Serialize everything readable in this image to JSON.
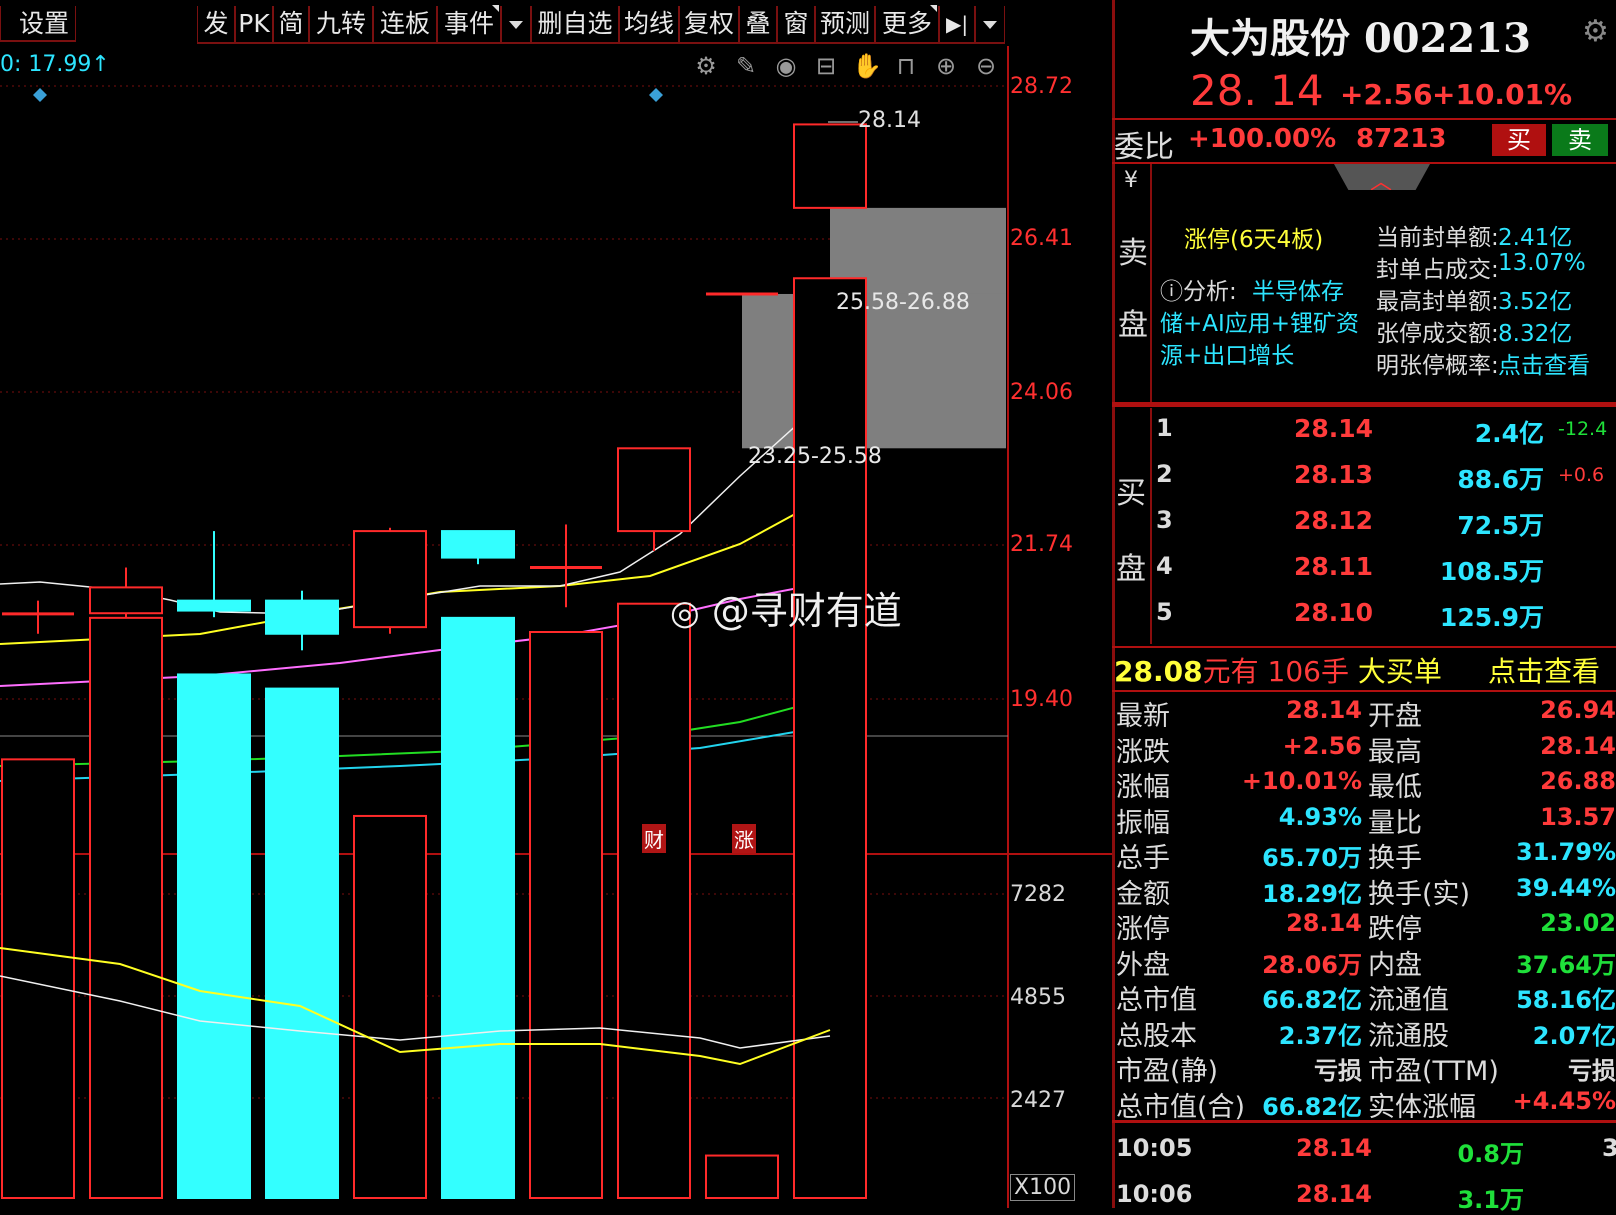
{
  "toolbar": {
    "items": [
      "设置",
      "发",
      "PK",
      "简",
      "九转",
      "连板",
      "事件",
      "",
      "删自选",
      "均线",
      "复权",
      "叠",
      "窗",
      "预测",
      "更多",
      "",
      ""
    ],
    "ma_readout": "0: 17.99↑"
  },
  "price_axis": [
    "28.72",
    "26.41",
    "24.06",
    "21.74",
    "19.40"
  ],
  "volume_axis": [
    "7282",
    "4855",
    "2427",
    "X100"
  ],
  "chart": {
    "high_label": "28.14",
    "zone_upper": "25.58-26.88",
    "zone_lower": "23.25-25.58",
    "markers": [
      "财",
      "涨"
    ],
    "watermark": "@寻财有道"
  },
  "chart_data": {
    "type": "candlestick",
    "candles": [
      {
        "o": 20.75,
        "c": 20.75,
        "h": 20.95,
        "l": 20.45
      },
      {
        "o": 20.76,
        "c": 21.15,
        "h": 21.45,
        "l": 20.65
      },
      {
        "o": 20.95,
        "c": 20.8,
        "h": 22.0,
        "l": 20.7
      },
      {
        "o": 20.95,
        "c": 20.45,
        "h": 21.1,
        "l": 20.2
      },
      {
        "o": 20.55,
        "c": 22.0,
        "h": 22.05,
        "l": 20.45
      },
      {
        "o": 22.0,
        "c": 21.6,
        "h": 22.0,
        "l": 21.5
      },
      {
        "o": 21.45,
        "c": 21.45,
        "h": 22.1,
        "l": 20.85
      },
      {
        "o": 22.0,
        "c": 23.25,
        "h": 23.25,
        "l": 21.7
      },
      {
        "o": 25.58,
        "c": 25.58,
        "h": 25.58,
        "l": 25.58
      },
      {
        "o": 26.88,
        "c": 28.14,
        "h": 28.14,
        "l": 26.88
      }
    ],
    "volume": [
      3100,
      4100,
      3700,
      3600,
      2700,
      4100,
      4000,
      4200,
      300,
      6500
    ],
    "volume_colors": [
      "red",
      "red",
      "cyan",
      "cyan",
      "red",
      "cyan",
      "red",
      "red",
      "red",
      "red"
    ]
  },
  "stock": {
    "name": "大为股份",
    "code": "002213",
    "price": "28. 14",
    "change": "+2.56",
    "pct": "+10.01%",
    "ratio_label": "委比",
    "ratio": "+100.00%",
    "ratio_vol": "87213",
    "buy": "买",
    "sell": "卖"
  },
  "limit": {
    "yen": "¥",
    "title": "涨停(6天4板)",
    "analysis_label": "ⓘ分析:",
    "analysis": [
      "半导体存",
      "储+AI应用+锂矿资",
      "源+出口增长"
    ],
    "stats": [
      {
        "k": "当前封单额:",
        "v": "2.41亿"
      },
      {
        "k": "封单占成交:",
        "v": "13.07%"
      },
      {
        "k": "最高封单额:",
        "v": "3.52亿"
      },
      {
        "k": "张停成交额:",
        "v": "8.32亿"
      },
      {
        "k": "明张停概率:",
        "v": "点击查看"
      }
    ],
    "sell_label": [
      "卖",
      "盘"
    ]
  },
  "bids": {
    "label": [
      "买",
      "盘"
    ],
    "rows": [
      {
        "n": "1",
        "p": "28.14",
        "v": "2.4亿",
        "d": "-12.4"
      },
      {
        "n": "2",
        "p": "28.13",
        "v": "88.6万",
        "d": "+0.6"
      },
      {
        "n": "3",
        "p": "28.12",
        "v": "72.5万",
        "d": ""
      },
      {
        "n": "4",
        "p": "28.11",
        "v": "108.5万",
        "d": ""
      },
      {
        "n": "5",
        "p": "28.10",
        "v": "125.9万",
        "d": ""
      }
    ]
  },
  "bigorder": {
    "price": "28.08",
    "t1": "元有",
    "count": "106手",
    "t2": "大买单",
    "link": "点击查看"
  },
  "quote": [
    {
      "k1": "最新",
      "v1": "28.14",
      "c1": "r",
      "k2": "开盘",
      "v2": "26.94",
      "c2": "r"
    },
    {
      "k1": "涨跌",
      "v1": "+2.56",
      "c1": "r",
      "k2": "最高",
      "v2": "28.14",
      "c2": "r"
    },
    {
      "k1": "涨幅",
      "v1": "+10.01%",
      "c1": "r",
      "k2": "最低",
      "v2": "26.88",
      "c2": "r"
    },
    {
      "k1": "振幅",
      "v1": "4.93%",
      "c1": "c",
      "k2": "量比",
      "v2": "13.57",
      "c2": "r"
    },
    {
      "k1": "总手",
      "v1": "65.70万",
      "c1": "c",
      "k2": "换手",
      "v2": "31.79%",
      "c2": "c"
    },
    {
      "k1": "金额",
      "v1": "18.29亿",
      "c1": "c",
      "k2": "换手(实)",
      "v2": "39.44%",
      "c2": "c"
    },
    {
      "k1": "涨停",
      "v1": "28.14",
      "c1": "r",
      "k2": "跌停",
      "v2": "23.02",
      "c2": "g"
    },
    {
      "k1": "外盘",
      "v1": "28.06万",
      "c1": "r",
      "k2": "内盘",
      "v2": "37.64万",
      "c2": "g"
    },
    {
      "k1": "总市值",
      "v1": "66.82亿",
      "c1": "c",
      "k2": "流通值",
      "v2": "58.16亿",
      "c2": "c"
    },
    {
      "k1": "总股本",
      "v1": "2.37亿",
      "c1": "c",
      "k2": "流通股",
      "v2": "2.07亿",
      "c2": "c"
    },
    {
      "k1": "市盈(静)",
      "v1": "亏损",
      "c1": "w",
      "k2": "市盈(TTM)",
      "v2": "亏损",
      "c2": "w"
    },
    {
      "k1": "总市值(合)",
      "v1": "66.82亿",
      "c1": "c",
      "k2": "实体涨幅",
      "v2": "+4.45%",
      "c2": "r"
    }
  ],
  "ticks": [
    {
      "t": "10:05",
      "p": "28.14",
      "v": "0.8万",
      "n": "3"
    },
    {
      "t": "10:06",
      "p": "28.14",
      "v": "3.1万",
      "n": ""
    }
  ]
}
